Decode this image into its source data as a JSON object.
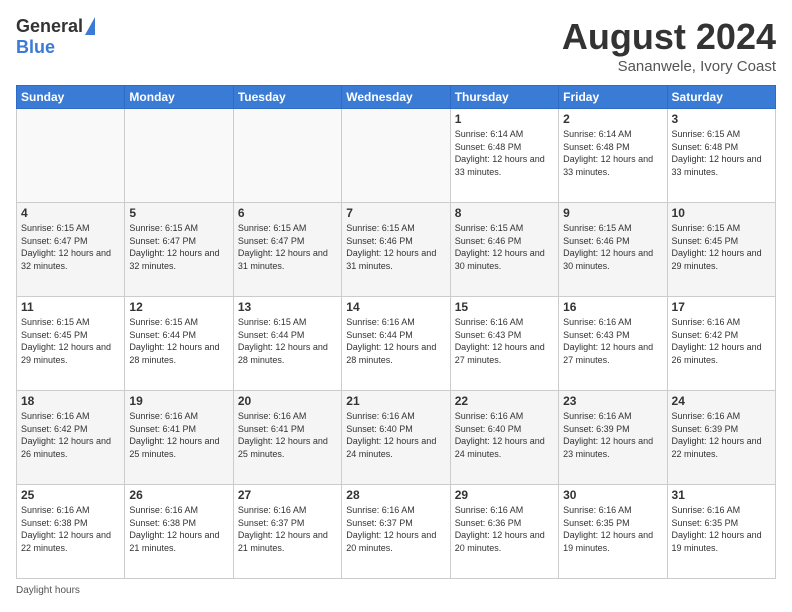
{
  "logo": {
    "general": "General",
    "blue": "Blue"
  },
  "header": {
    "month": "August 2024",
    "location": "Sananwele, Ivory Coast"
  },
  "days_of_week": [
    "Sunday",
    "Monday",
    "Tuesday",
    "Wednesday",
    "Thursday",
    "Friday",
    "Saturday"
  ],
  "footer_text": "Daylight hours",
  "weeks": [
    [
      {
        "day": "",
        "empty": true
      },
      {
        "day": "",
        "empty": true
      },
      {
        "day": "",
        "empty": true
      },
      {
        "day": "",
        "empty": true
      },
      {
        "day": "1",
        "sunrise": "6:14 AM",
        "sunset": "6:48 PM",
        "daylight": "12 hours and 33 minutes."
      },
      {
        "day": "2",
        "sunrise": "6:14 AM",
        "sunset": "6:48 PM",
        "daylight": "12 hours and 33 minutes."
      },
      {
        "day": "3",
        "sunrise": "6:15 AM",
        "sunset": "6:48 PM",
        "daylight": "12 hours and 33 minutes."
      }
    ],
    [
      {
        "day": "4",
        "sunrise": "6:15 AM",
        "sunset": "6:47 PM",
        "daylight": "12 hours and 32 minutes."
      },
      {
        "day": "5",
        "sunrise": "6:15 AM",
        "sunset": "6:47 PM",
        "daylight": "12 hours and 32 minutes."
      },
      {
        "day": "6",
        "sunrise": "6:15 AM",
        "sunset": "6:47 PM",
        "daylight": "12 hours and 31 minutes."
      },
      {
        "day": "7",
        "sunrise": "6:15 AM",
        "sunset": "6:46 PM",
        "daylight": "12 hours and 31 minutes."
      },
      {
        "day": "8",
        "sunrise": "6:15 AM",
        "sunset": "6:46 PM",
        "daylight": "12 hours and 30 minutes."
      },
      {
        "day": "9",
        "sunrise": "6:15 AM",
        "sunset": "6:46 PM",
        "daylight": "12 hours and 30 minutes."
      },
      {
        "day": "10",
        "sunrise": "6:15 AM",
        "sunset": "6:45 PM",
        "daylight": "12 hours and 29 minutes."
      }
    ],
    [
      {
        "day": "11",
        "sunrise": "6:15 AM",
        "sunset": "6:45 PM",
        "daylight": "12 hours and 29 minutes."
      },
      {
        "day": "12",
        "sunrise": "6:15 AM",
        "sunset": "6:44 PM",
        "daylight": "12 hours and 28 minutes."
      },
      {
        "day": "13",
        "sunrise": "6:15 AM",
        "sunset": "6:44 PM",
        "daylight": "12 hours and 28 minutes."
      },
      {
        "day": "14",
        "sunrise": "6:16 AM",
        "sunset": "6:44 PM",
        "daylight": "12 hours and 28 minutes."
      },
      {
        "day": "15",
        "sunrise": "6:16 AM",
        "sunset": "6:43 PM",
        "daylight": "12 hours and 27 minutes."
      },
      {
        "day": "16",
        "sunrise": "6:16 AM",
        "sunset": "6:43 PM",
        "daylight": "12 hours and 27 minutes."
      },
      {
        "day": "17",
        "sunrise": "6:16 AM",
        "sunset": "6:42 PM",
        "daylight": "12 hours and 26 minutes."
      }
    ],
    [
      {
        "day": "18",
        "sunrise": "6:16 AM",
        "sunset": "6:42 PM",
        "daylight": "12 hours and 26 minutes."
      },
      {
        "day": "19",
        "sunrise": "6:16 AM",
        "sunset": "6:41 PM",
        "daylight": "12 hours and 25 minutes."
      },
      {
        "day": "20",
        "sunrise": "6:16 AM",
        "sunset": "6:41 PM",
        "daylight": "12 hours and 25 minutes."
      },
      {
        "day": "21",
        "sunrise": "6:16 AM",
        "sunset": "6:40 PM",
        "daylight": "12 hours and 24 minutes."
      },
      {
        "day": "22",
        "sunrise": "6:16 AM",
        "sunset": "6:40 PM",
        "daylight": "12 hours and 24 minutes."
      },
      {
        "day": "23",
        "sunrise": "6:16 AM",
        "sunset": "6:39 PM",
        "daylight": "12 hours and 23 minutes."
      },
      {
        "day": "24",
        "sunrise": "6:16 AM",
        "sunset": "6:39 PM",
        "daylight": "12 hours and 22 minutes."
      }
    ],
    [
      {
        "day": "25",
        "sunrise": "6:16 AM",
        "sunset": "6:38 PM",
        "daylight": "12 hours and 22 minutes."
      },
      {
        "day": "26",
        "sunrise": "6:16 AM",
        "sunset": "6:38 PM",
        "daylight": "12 hours and 21 minutes."
      },
      {
        "day": "27",
        "sunrise": "6:16 AM",
        "sunset": "6:37 PM",
        "daylight": "12 hours and 21 minutes."
      },
      {
        "day": "28",
        "sunrise": "6:16 AM",
        "sunset": "6:37 PM",
        "daylight": "12 hours and 20 minutes."
      },
      {
        "day": "29",
        "sunrise": "6:16 AM",
        "sunset": "6:36 PM",
        "daylight": "12 hours and 20 minutes."
      },
      {
        "day": "30",
        "sunrise": "6:16 AM",
        "sunset": "6:35 PM",
        "daylight": "12 hours and 19 minutes."
      },
      {
        "day": "31",
        "sunrise": "6:16 AM",
        "sunset": "6:35 PM",
        "daylight": "12 hours and 19 minutes."
      }
    ]
  ]
}
